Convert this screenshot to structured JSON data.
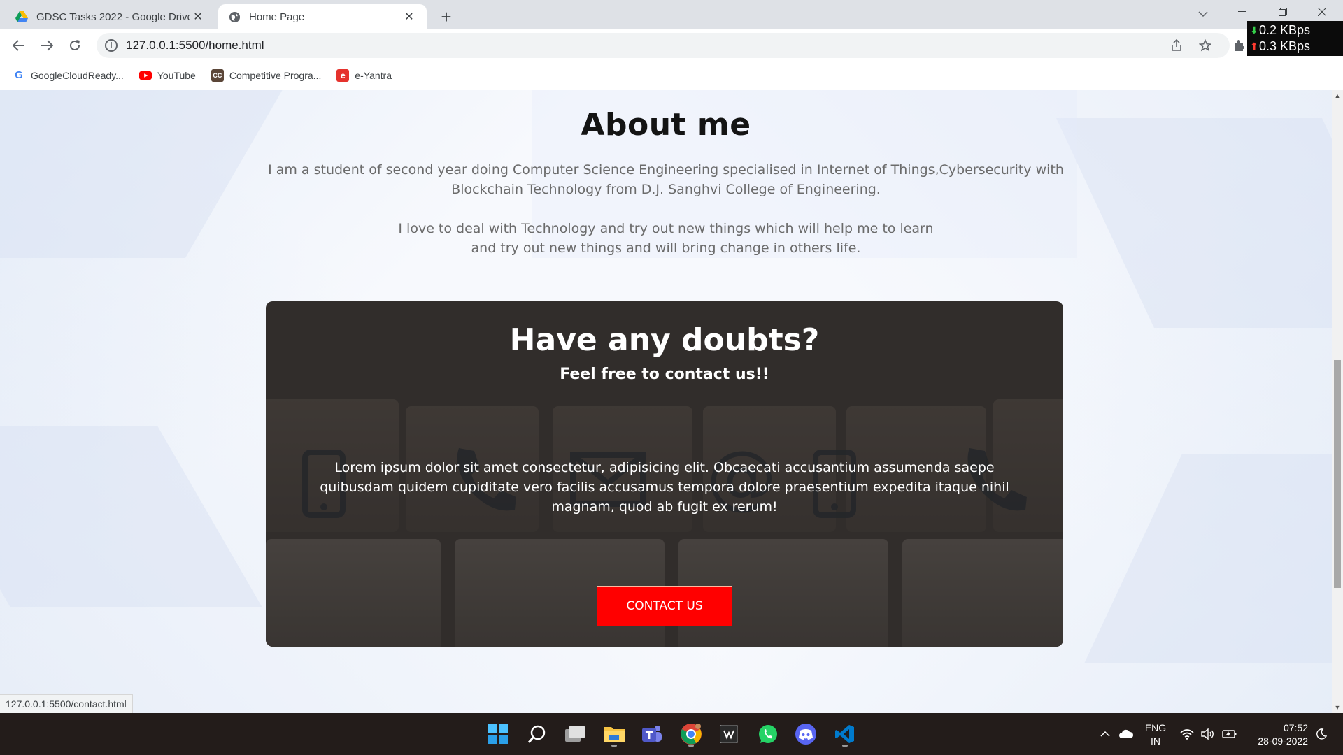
{
  "browser": {
    "tabs": [
      {
        "title": "GDSC Tasks 2022 - Google Drive",
        "icon": "google-drive-icon",
        "active": false
      },
      {
        "title": "Home Page",
        "icon": "globe-icon",
        "active": true
      }
    ],
    "address": "127.0.0.1:5500/home.html",
    "bookmarks": [
      {
        "label": "GoogleCloudReady...",
        "icon": "google-icon"
      },
      {
        "label": "YouTube",
        "icon": "youtube-icon"
      },
      {
        "label": "Competitive Progra...",
        "icon": "codechef-icon"
      },
      {
        "label": "e-Yantra",
        "icon": "e-yantra-icon"
      }
    ],
    "status_url": "127.0.0.1:5500/contact.html"
  },
  "net_speed": {
    "down": "0.2 KBps",
    "up": "0.3 KBps",
    "down_color": "#35d04a",
    "up_color": "#ff3b30"
  },
  "about": {
    "title": "About me",
    "paragraph1": "I am a student of second year doing Computer Science Engineering specialised in Internet of Things,Cybersecurity with Blockchain Technology from D.J. Sanghvi College of Engineering.",
    "paragraph2": "I love to deal with Technology and try out new things which will help me to learn and try out new things and will bring change in others life."
  },
  "contact": {
    "title": "Have any doubts?",
    "subtitle": "Feel free to contact us!!",
    "body": "Lorem ipsum dolor sit amet consectetur, adipisicing elit. Obcaecati accusantium assumenda saepe quibusdam quidem cupiditate vero facilis accusamus tempora dolore praesentium expedita itaque nihil magnam, quod ab fugit ex rerum!",
    "button": "CONTACT US",
    "button_color": "#ff0000"
  },
  "taskbar": {
    "apps": [
      "windows-start-icon",
      "search-icon",
      "task-view-icon",
      "file-explorer-icon",
      "teams-icon",
      "chrome-icon",
      "app-icon",
      "whatsapp-icon",
      "discord-icon",
      "vscode-icon"
    ],
    "lang_line1": "ENG",
    "lang_line2": "IN",
    "time": "07:52",
    "date": "28-09-2022"
  }
}
